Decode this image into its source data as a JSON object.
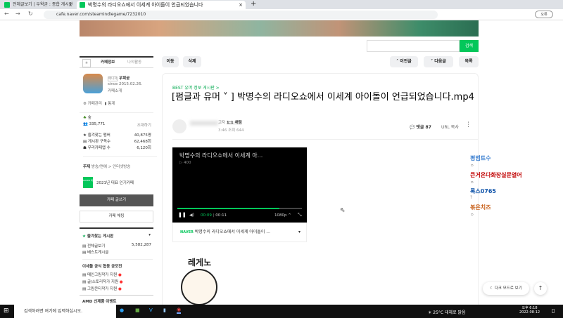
{
  "browser": {
    "tabs": [
      {
        "label": "전체글보기 | 우왁굳 : 종합 게시판"
      },
      {
        "label": "박명수의 라디오쇼에서 이세계 아이돌이 언급되었습니다"
      }
    ],
    "new_tab": "+",
    "url": "cafe.naver.com/steamindiegame/7232010",
    "profile_label": "오류"
  },
  "search": {
    "button": "검색",
    "placeholder": ""
  },
  "toolbar": {
    "move": "이동",
    "delete": "삭제",
    "prev": "이전글",
    "next": "다음글",
    "list": "목록"
  },
  "sidebar": {
    "tab_info": "카페정보",
    "tab_activity": "나의활동",
    "manager_badge": "매니저",
    "cafe_name": "우왁굳",
    "since": "since 2015.02.26.",
    "intro": "카페소개",
    "cafe_level_link": "카페관리",
    "stats_link": "통계",
    "level": "숲",
    "members": "335,771",
    "invite": "초대하기",
    "stats": [
      {
        "label": "즐겨찾는 멤버",
        "value": "40,875명"
      },
      {
        "label": "게시판 구독수",
        "value": "62,468회"
      },
      {
        "label": "우리카페앱 수",
        "value": "6,120회"
      }
    ],
    "topic_label": "주제",
    "topic": "방송/연예 > 인터넷방송",
    "award_badge": "NAVER 대표카페",
    "award": "2021년 대표 인기카페",
    "write": "카페 글쓰기",
    "chat": "카페 채팅",
    "fav_boards": "즐겨찾는 게시판",
    "boards": [
      {
        "label": "전체글보기",
        "count": "5,582,287"
      },
      {
        "label": "베스트게시글",
        "count": ""
      }
    ],
    "section1": "이세돌 공식 협동 공모전",
    "contest": [
      {
        "label": "메인그림작가 지원"
      },
      {
        "label": "글/스토리작가 지원"
      },
      {
        "label": "그림콘티작가 지원"
      }
    ],
    "section2": "AMD 신제품 이벤트"
  },
  "article": {
    "board": "BEST 유머 정보 게시판 >",
    "title": "[펌글과 유머 ˅ ] 박명수의 라디오쇼에서 이세계 아이돌이 언급되었습니다.mp4",
    "author_rank": "1:1 채팅",
    "author_suffix": "고자",
    "time": "3:46",
    "views": "조회 644",
    "comments": "댓글 87",
    "url_copy": "URL 복사"
  },
  "video": {
    "title": "박명수의 라디오쇼에서 이세계 아...",
    "plays": "▷ 400",
    "time_current": "00:09",
    "time_total": "00:11",
    "quality": "1080p ^",
    "caption_brand": "NAVER",
    "caption": "박명수의 라디오쇼에서 이세계 아이돌이 ...",
    "progress": 0.82
  },
  "sticker_text": "레게노",
  "chat_list": [
    {
      "name": "평범트수",
      "sub": "ㅇ",
      "color": "#3b7fd0"
    },
    {
      "name": "큰거온다화장실문열어",
      "sub": "ㅇ",
      "color": "#c00000"
    },
    {
      "name": "록스0765",
      "sub": "?",
      "color": "#1155aa"
    },
    {
      "name": "볶은치즈",
      "sub": "ㅇ",
      "color": "#c8601a"
    }
  ],
  "floating": {
    "dark_mode": "다크 모드로 보기",
    "top": "↑"
  },
  "taskbar": {
    "search": "검색하려면 여기에 입력하십시오.",
    "weather": "25°C 대체로 맑음",
    "time": "오후 6:18",
    "date": "2022-08-12"
  }
}
